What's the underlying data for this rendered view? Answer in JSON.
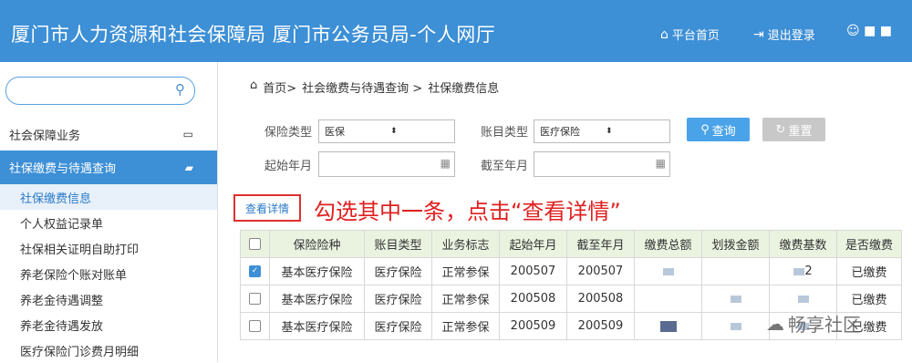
{
  "header": {
    "title": "厦门市人力资源和社会保障局 厦门市公务员局-个人网厅",
    "home_link": "平台首页",
    "logout_link": "退出登录",
    "user_label": "■ ■"
  },
  "sidebar": {
    "search": {
      "value": "",
      "placeholder": ""
    },
    "groups": [
      {
        "label": "社会保障业务"
      },
      {
        "label": "社保缴费与待遇查询"
      }
    ],
    "items": [
      {
        "label": "社保缴费信息"
      },
      {
        "label": "个人权益记录单"
      },
      {
        "label": "社保相关证明自助打印"
      },
      {
        "label": "养老保险个账对账单"
      },
      {
        "label": "养老金待遇调整"
      },
      {
        "label": "养老金待遇发放"
      },
      {
        "label": "医疗保险门诊费月明细"
      }
    ]
  },
  "breadcrumb": {
    "home": "首页>",
    "level1": "社会缴费与待遇查询 >",
    "level2": "社保缴费信息"
  },
  "form": {
    "insurance_type_label": "保险类型",
    "insurance_type_value": "医保",
    "account_type_label": "账目类型",
    "account_type_value": "医疗保险",
    "start_label": "起始年月",
    "end_label": "截至年月",
    "query_button": "查询",
    "reset_button": "重置"
  },
  "detail_button": "查看详情",
  "annotation": "勾选其中一条，点击“查看详情”",
  "table": {
    "headers": [
      "保险险种",
      "账目类型",
      "业务标志",
      "起始年月",
      "截至年月",
      "缴费总额",
      "划拨金额",
      "缴费基数",
      "是否缴费"
    ],
    "rows": [
      {
        "checked": true,
        "cells": [
          "基本医疗保险",
          "医疗保险",
          "正常参保",
          "200507",
          "200507",
          "",
          "",
          "2",
          "已缴费"
        ]
      },
      {
        "checked": false,
        "cells": [
          "基本医疗保险",
          "医疗保险",
          "正常参保",
          "200508",
          "200508",
          "",
          "",
          "",
          "已缴费"
        ]
      },
      {
        "checked": false,
        "cells": [
          "基本医疗保险",
          "医疗保险",
          "正常参保",
          "200509",
          "200509",
          "",
          "",
          "",
          "已缴费"
        ]
      }
    ]
  },
  "watermark": "畅享社区",
  "colors": {
    "brand": "#3d8fd6",
    "annotation": "#e02020",
    "header_row": "#eaf3e0"
  }
}
